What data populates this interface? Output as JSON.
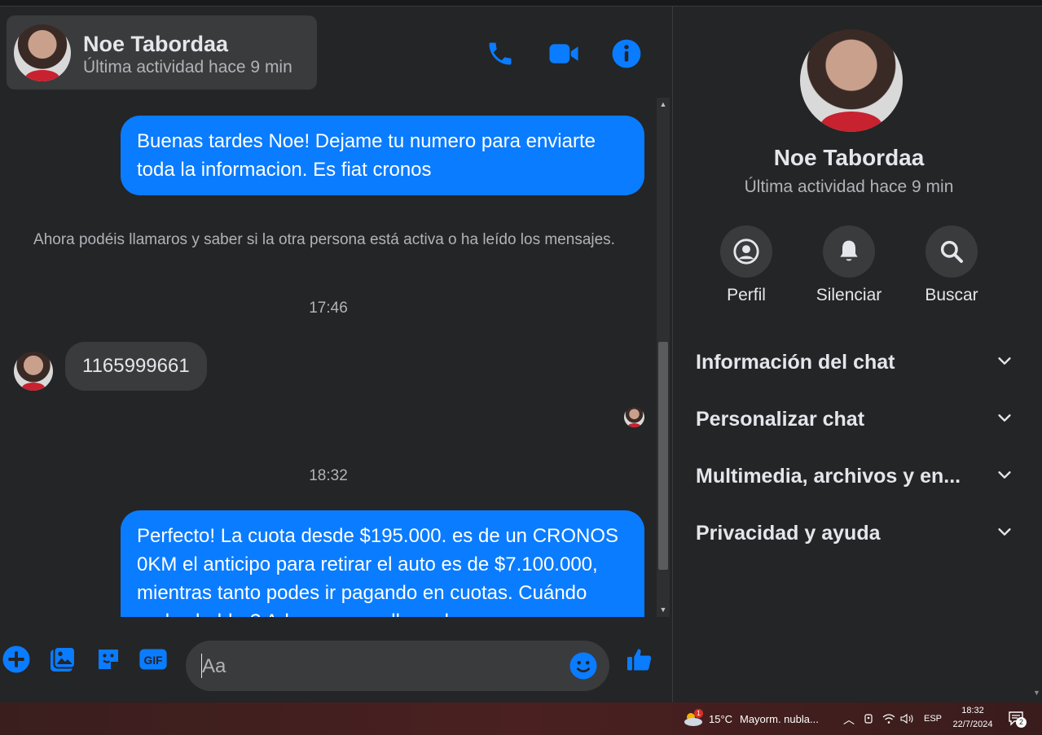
{
  "contact": {
    "name": "Noe Tabordaa",
    "status": "Última actividad hace 9 min"
  },
  "header_icons": [
    "phone-icon",
    "video-icon",
    "info-icon"
  ],
  "thread": {
    "msg1": "Buenas tardes Noe! Dejame tu numero para enviarte toda la informacion. Es fiat cronos",
    "notice": "Ahora podéis llamaros y saber si la otra persona está activa o ha leído los mensajes.",
    "time1": "17:46",
    "msg2": "1165999661",
    "time2": "18:32",
    "msg3": "Perfecto! La cuota desde $195.000. es de un CRONOS 0KM el anticipo para retirar el auto es de $7.100.000, mientras tanto podes ir pagando en cuotas. Cuándo podes hablar? Adoamos una llamada."
  },
  "composer": {
    "placeholder": "Aa",
    "icons": [
      "plus-icon",
      "image-icon",
      "sticker-icon",
      "gif-icon",
      "emoji-icon",
      "like-icon"
    ],
    "gif_label": "GIF"
  },
  "sidebar": {
    "actions": [
      {
        "label": "Perfil",
        "icon": "profile-icon"
      },
      {
        "label": "Silenciar",
        "icon": "bell-icon"
      },
      {
        "label": "Buscar",
        "icon": "search-icon"
      }
    ],
    "sections": [
      "Información del chat",
      "Personalizar chat",
      "Multimedia, archivos y en...",
      "Privacidad y ayuda"
    ]
  },
  "taskbar": {
    "weather_temp": "15°C",
    "weather_text": "Mayorm. nubla...",
    "weather_badge": "1",
    "lang": "ESP",
    "time": "18:32",
    "date": "22/7/2024",
    "notif_count": "2"
  },
  "colors": {
    "accent": "#0a7cff",
    "background": "#242526",
    "surface": "#3a3b3c"
  }
}
